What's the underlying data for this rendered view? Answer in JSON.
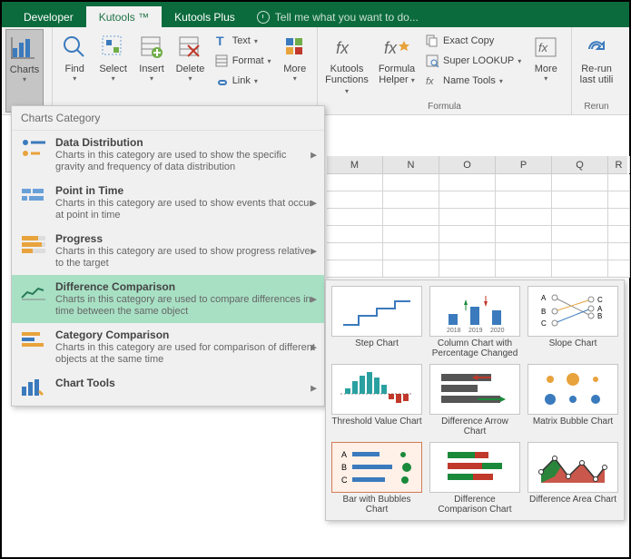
{
  "tabs": {
    "developer": "Developer",
    "kutools": "Kutools ™",
    "kutoolsplus": "Kutools Plus",
    "tellme": "Tell me what you want to do..."
  },
  "ribbon": {
    "charts": "Charts",
    "find": "Find",
    "select": "Select",
    "insert": "Insert",
    "delete": "Delete",
    "text": "Text",
    "format": "Format",
    "link": "Link",
    "more1": "More",
    "kfunctions_l1": "Kutools",
    "kfunctions_l2": "Functions",
    "fhelper_l1": "Formula",
    "fhelper_l2": "Helper",
    "exactcopy": "Exact Copy",
    "superlookup": "Super LOOKUP",
    "nametools": "Name Tools",
    "more2": "More",
    "rerun_l1": "Re-run",
    "rerun_l2": "last utili",
    "group_formula": "Formula",
    "group_rerun": "Rerun"
  },
  "dropdown": {
    "header": "Charts Category",
    "items": [
      {
        "title": "Data Distribution",
        "desc": "Charts in this category are used to show the specific gravity and frequency of data distribution"
      },
      {
        "title": "Point in Time",
        "desc": "Charts in this category are used to show events that occur at point in time"
      },
      {
        "title": "Progress",
        "desc": "Charts in this category are used to show progress relative to the target"
      },
      {
        "title": "Difference Comparison",
        "desc": "Charts in this category are used to compare differences in time between the same object"
      },
      {
        "title": "Category Comparison",
        "desc": "Charts in this category are used for comparison of different objects at the same time"
      },
      {
        "title": "Chart Tools",
        "desc": ""
      }
    ]
  },
  "submenu": {
    "labels": [
      "Step Chart",
      "Column Chart with Percentage Changed",
      "Slope Chart",
      "Threshold Value Chart",
      "Difference Arrow Chart",
      "Matrix Bubble Chart",
      "Bar with Bubbles Chart",
      "Difference Comparison Chart",
      "Difference Area Chart"
    ],
    "years": [
      "2018",
      "2019",
      "2020"
    ],
    "slope": {
      "lA": "A",
      "lB": "B",
      "lC": "C",
      "rC": "C",
      "rA": "A",
      "rB": "B"
    },
    "bwb": {
      "a": "A",
      "b": "B",
      "c": "C"
    }
  },
  "columns": [
    "M",
    "N",
    "O",
    "P",
    "Q",
    "R"
  ]
}
